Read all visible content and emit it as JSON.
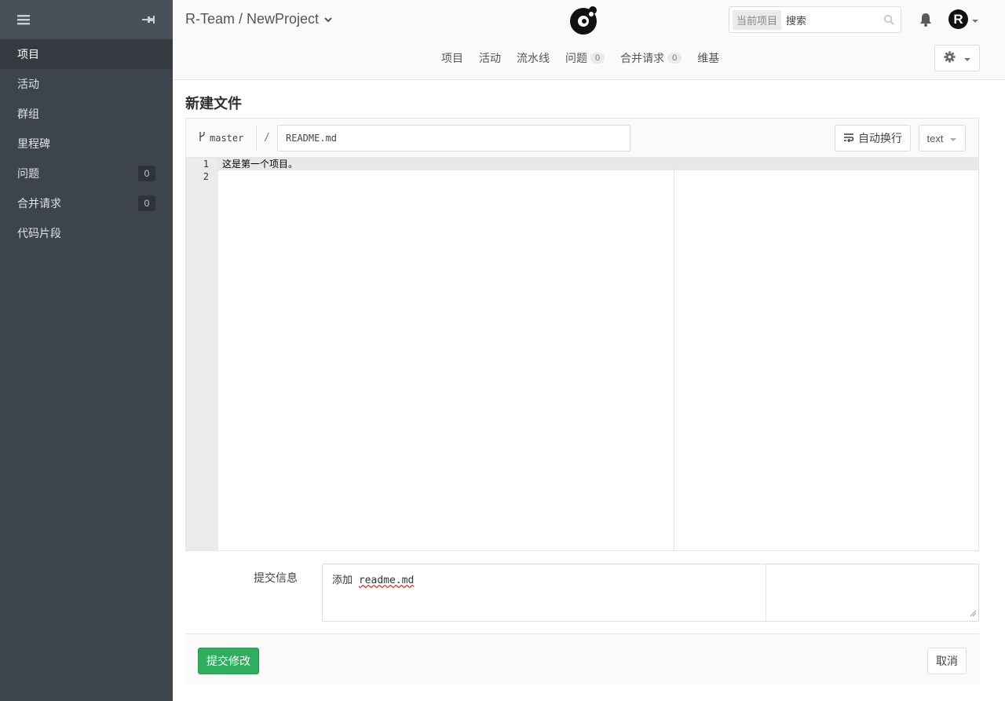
{
  "sidebar": {
    "items": [
      {
        "label": "项目"
      },
      {
        "label": "活动"
      },
      {
        "label": "群组"
      },
      {
        "label": "里程碑"
      },
      {
        "label": "问题",
        "count": "0"
      },
      {
        "label": "合并请求",
        "count": "0"
      },
      {
        "label": "代码片段"
      }
    ]
  },
  "header": {
    "project_title": "R-Team / NewProject",
    "search_scope": "当前项目",
    "search_placeholder": "搜索",
    "avatar_letter": "R",
    "tabs": [
      {
        "label": "项目"
      },
      {
        "label": "活动"
      },
      {
        "label": "流水线"
      },
      {
        "label": "问题",
        "count": "0"
      },
      {
        "label": "合并请求",
        "count": "0"
      },
      {
        "label": "维基"
      }
    ]
  },
  "page": {
    "title": "新建文件",
    "branch": "master",
    "path_sep": "/",
    "filename": "README.md",
    "wrap_label": "自动换行",
    "mode": "text",
    "line_numbers": [
      "1",
      "2"
    ],
    "code_lines": [
      "这是第一个项目。",
      ""
    ],
    "commit_label": "提交信息",
    "commit_prefix": "添加",
    "commit_file": "readme.md",
    "submit_label": "提交修改",
    "cancel_label": "取消"
  },
  "colors": {
    "sidebar": "#3e444c",
    "primary_button": "#2fae5f"
  }
}
